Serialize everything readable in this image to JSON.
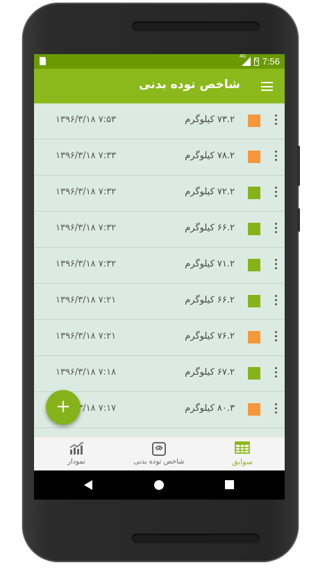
{
  "status_bar": {
    "time": "7:56",
    "network": "4G"
  },
  "toolbar": {
    "title": "شاخص توده بدنی"
  },
  "colors": {
    "orange": "#f5973a",
    "green": "#86b31a"
  },
  "records": [
    {
      "weight": "۷۳.۲ کیلوگرم",
      "datetime": "۱۳۹۶/۳/۱۸ ۷:۵۳",
      "color": "orange"
    },
    {
      "weight": "۷۸.۲ کیلوگرم",
      "datetime": "۱۳۹۶/۳/۱۸ ۷:۳۳",
      "color": "orange"
    },
    {
      "weight": "۷۲.۲ کیلوگرم",
      "datetime": "۱۳۹۶/۳/۱۸ ۷:۳۲",
      "color": "green"
    },
    {
      "weight": "۶۶.۲ کیلوگرم",
      "datetime": "۱۳۹۶/۳/۱۸ ۷:۳۲",
      "color": "green"
    },
    {
      "weight": "۷۱.۲ کیلوگرم",
      "datetime": "۱۳۹۶/۳/۱۸ ۷:۳۲",
      "color": "green"
    },
    {
      "weight": "۶۶.۲ کیلوگرم",
      "datetime": "۱۳۹۶/۳/۱۸ ۷:۲۱",
      "color": "green"
    },
    {
      "weight": "۷۶.۲ کیلوگرم",
      "datetime": "۱۳۹۶/۳/۱۸ ۷:۲۱",
      "color": "orange"
    },
    {
      "weight": "۶۷.۲ کیلوگرم",
      "datetime": "۱۳۹۶/۳/۱۸ ۷:۱۸",
      "color": "green"
    },
    {
      "weight": "۸۰.۳ کیلوگرم",
      "datetime": "۱۳۹۶/۳/۱۸ ۷:۱۷",
      "color": "orange"
    }
  ],
  "fab": {
    "label": "+"
  },
  "bottom_nav": {
    "chart": {
      "label": "نمودار",
      "icon": "chart-icon"
    },
    "bmi": {
      "label": "شاخص توده بدنی",
      "icon": "scale-icon"
    },
    "history": {
      "label": "سوابق",
      "icon": "table-icon",
      "active": true
    }
  }
}
